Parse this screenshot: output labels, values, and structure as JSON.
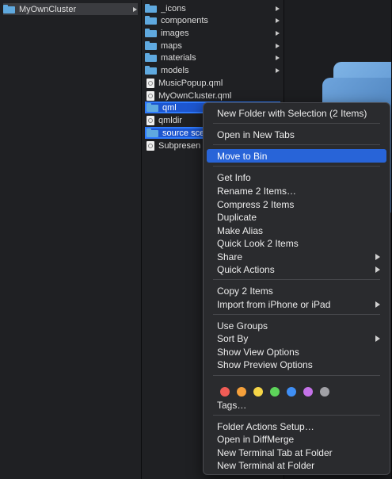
{
  "column1": {
    "items": [
      {
        "label": "MyOwnCluster"
      }
    ]
  },
  "column2": {
    "items": [
      {
        "label": "_icons"
      },
      {
        "label": "components"
      },
      {
        "label": "images"
      },
      {
        "label": "maps"
      },
      {
        "label": "materials"
      },
      {
        "label": "models"
      },
      {
        "label": "MusicPopup.qml"
      },
      {
        "label": "MyOwnCluster.qml"
      },
      {
        "label": "qml"
      },
      {
        "label": "qmldir"
      },
      {
        "label": "source sce"
      },
      {
        "label": "Subpresen"
      }
    ]
  },
  "menu": {
    "new_folder_selection": "New Folder with Selection (2 Items)",
    "open_new_tabs": "Open in New Tabs",
    "move_to_bin": "Move to Bin",
    "get_info": "Get Info",
    "rename": "Rename 2 Items…",
    "compress": "Compress 2 Items",
    "duplicate": "Duplicate",
    "make_alias": "Make Alias",
    "quick_look": "Quick Look 2 Items",
    "share": "Share",
    "quick_actions": "Quick Actions",
    "copy": "Copy 2 Items",
    "import_iphone": "Import from iPhone or iPad",
    "use_groups": "Use Groups",
    "sort_by": "Sort By",
    "show_view_options": "Show View Options",
    "show_preview_options": "Show Preview Options",
    "tags": "Tags…",
    "tag_colors": [
      "#f05c56",
      "#f5a03b",
      "#f5d547",
      "#5dd45a",
      "#3f8ff5",
      "#c472e8",
      "#a1a1a6"
    ],
    "folder_actions_setup": "Folder Actions Setup…",
    "open_in_diffmerge": "Open in DiffMerge",
    "new_terminal_tab": "New Terminal Tab at Folder",
    "new_terminal": "New Terminal at Folder"
  }
}
